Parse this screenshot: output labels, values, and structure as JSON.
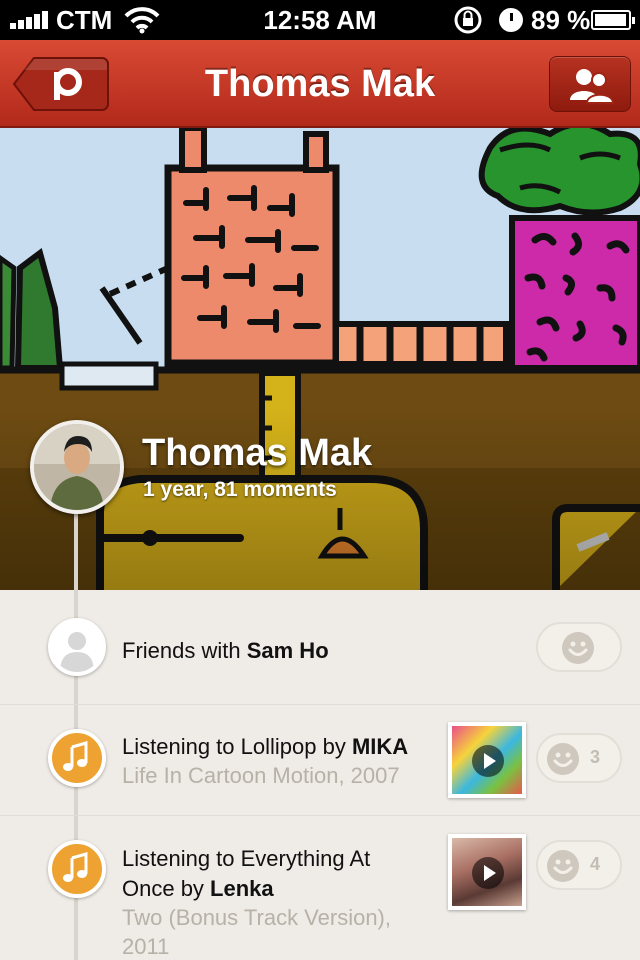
{
  "status_bar": {
    "carrier": "CTM",
    "time": "12:58 AM",
    "battery_percent": "89 %",
    "icons": [
      "signal-icon",
      "wifi-icon",
      "rotation-lock-icon",
      "alarm-icon",
      "battery-icon"
    ]
  },
  "nav": {
    "title": "Thomas Mak",
    "back_icon": "path-logo-icon",
    "right_icon": "friends-icon"
  },
  "profile": {
    "name": "Thomas Mak",
    "meta": "1 year, 81 moments"
  },
  "moments": [
    {
      "type": "friend",
      "icon": "person-icon",
      "prefix": "Friends with ",
      "bold": "Sam Ho",
      "smile_count": ""
    },
    {
      "type": "music",
      "icon": "music-note-icon",
      "prefix": "Listening to Lollipop by ",
      "bold": "MIKA",
      "sub": "Life In Cartoon Motion, 2007",
      "smile_count": "3"
    },
    {
      "type": "music",
      "icon": "music-note-icon",
      "prefix_line1": "Listening to Everything At",
      "prefix_line2": "Once by ",
      "bold": "Lenka",
      "sub_line1": "Two (Bonus Track Version),",
      "sub_line2": "2011",
      "smile_count": "4"
    }
  ],
  "colors": {
    "nav_red": "#c3371f",
    "music_orange": "#eea231",
    "feed_bg": "#efebe6"
  }
}
